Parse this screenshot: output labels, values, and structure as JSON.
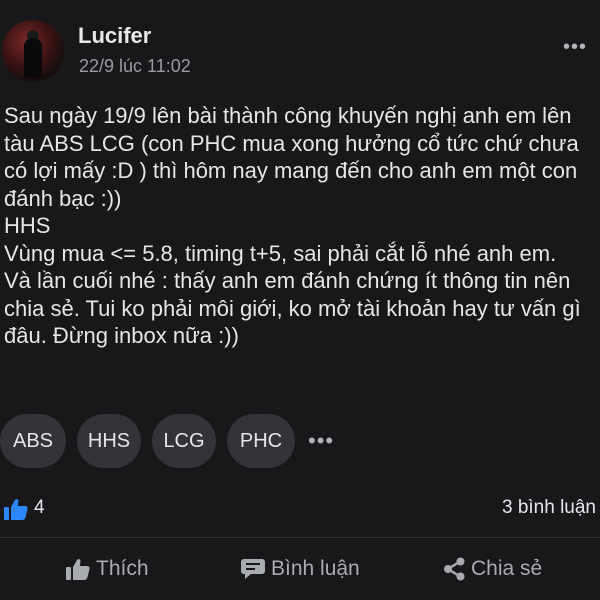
{
  "post": {
    "author": "Lucifer",
    "timestamp": "22/9 lúc 11:02",
    "body_paragraphs": [
      "Sau ngày 19/9 lên bài thành công khuyến nghị anh em lên tàu ABS LCG (con PHC mua xong hưởng cổ tức chứ chưa có lợi mấy :D ) thì hôm nay mang đến cho anh em một con đánh bạc :))",
      "HHS",
      "Vùng mua <= 5.8, timing t+5, sai phải cắt lỗ nhé anh em.",
      "Và lần cuối nhé : thấy anh em đánh chứng ít thông tin nên chia sẻ. Tui ko phải môi giới, ko mở tài khoản hay tư vấn gì đâu. Đừng inbox nữa :))"
    ],
    "tags": [
      "ABS",
      "HHS",
      "LCG",
      "PHC"
    ],
    "more_glyph": "•••",
    "tags_more_glyph": "•••",
    "like_count": "4",
    "comments_label": "3 bình luận"
  },
  "actions": {
    "like_label": "Thích",
    "comment_label": "Bình luận",
    "share_label": "Chia sẻ"
  },
  "colors": {
    "background": "#18181a",
    "tag_bg": "#333437",
    "like_blue": "#2d88ff",
    "muted_text": "#9a9ba0"
  },
  "icons": [
    "avatar",
    "more-options-icon",
    "like-reaction-icon",
    "thumbs-up-icon",
    "comment-icon",
    "share-icon"
  ]
}
